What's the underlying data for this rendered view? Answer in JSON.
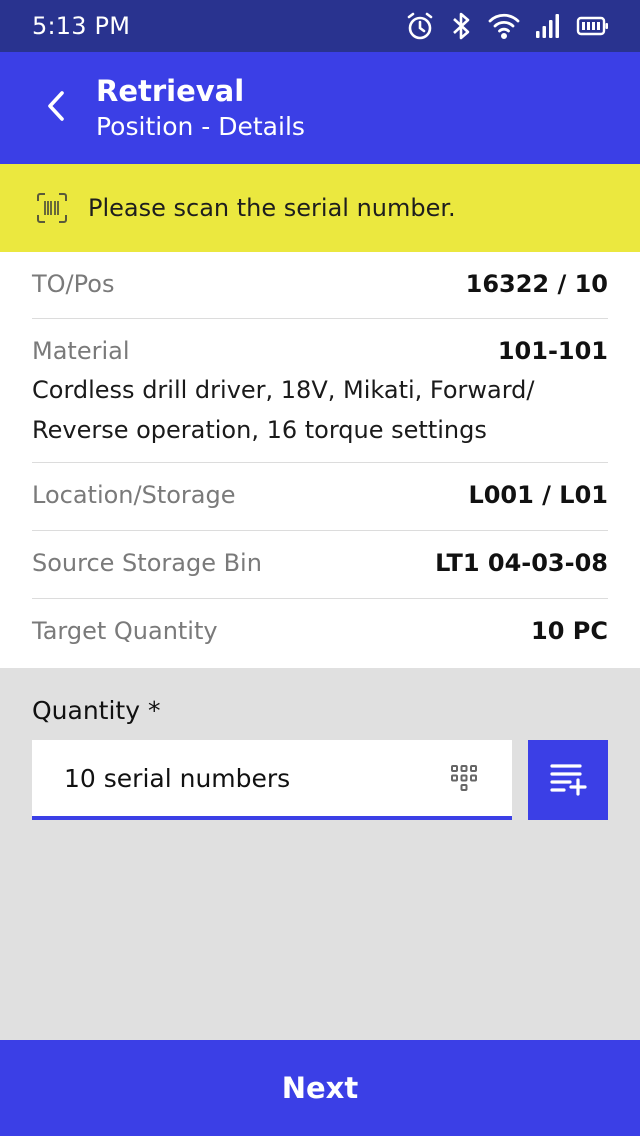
{
  "status_bar": {
    "time": "5:13 PM",
    "icons": [
      "alarm-icon",
      "bluetooth-icon",
      "wifi-icon",
      "signal-icon",
      "battery-icon"
    ]
  },
  "header": {
    "title": "Retrieval",
    "subtitle": "Position - Details"
  },
  "notice": {
    "text": "Please scan the serial number.",
    "icon": "barcode-scan-icon",
    "background": "#ebe83f"
  },
  "details": {
    "to_pos": {
      "label": "TO/Pos",
      "value": "16322 / 10"
    },
    "material": {
      "label": "Material",
      "value": "101-101",
      "description": "Cordless drill driver, 18V, Mikati, Forward/ Reverse operation, 16 torque settings"
    },
    "location": {
      "label": "Location/Storage",
      "value": "L001 / L01"
    },
    "source_bin": {
      "label": "Source Storage Bin",
      "value": "LT1 04-03-08"
    },
    "target_qty": {
      "label": "Target Quantity",
      "value": "10 PC"
    }
  },
  "quantity": {
    "label": "Quantity *",
    "value": "10 serial numbers"
  },
  "actions": {
    "next_label": "Next"
  },
  "colors": {
    "status_bar": "#29338f",
    "primary": "#3b3fe6",
    "notice": "#ebe83f"
  }
}
